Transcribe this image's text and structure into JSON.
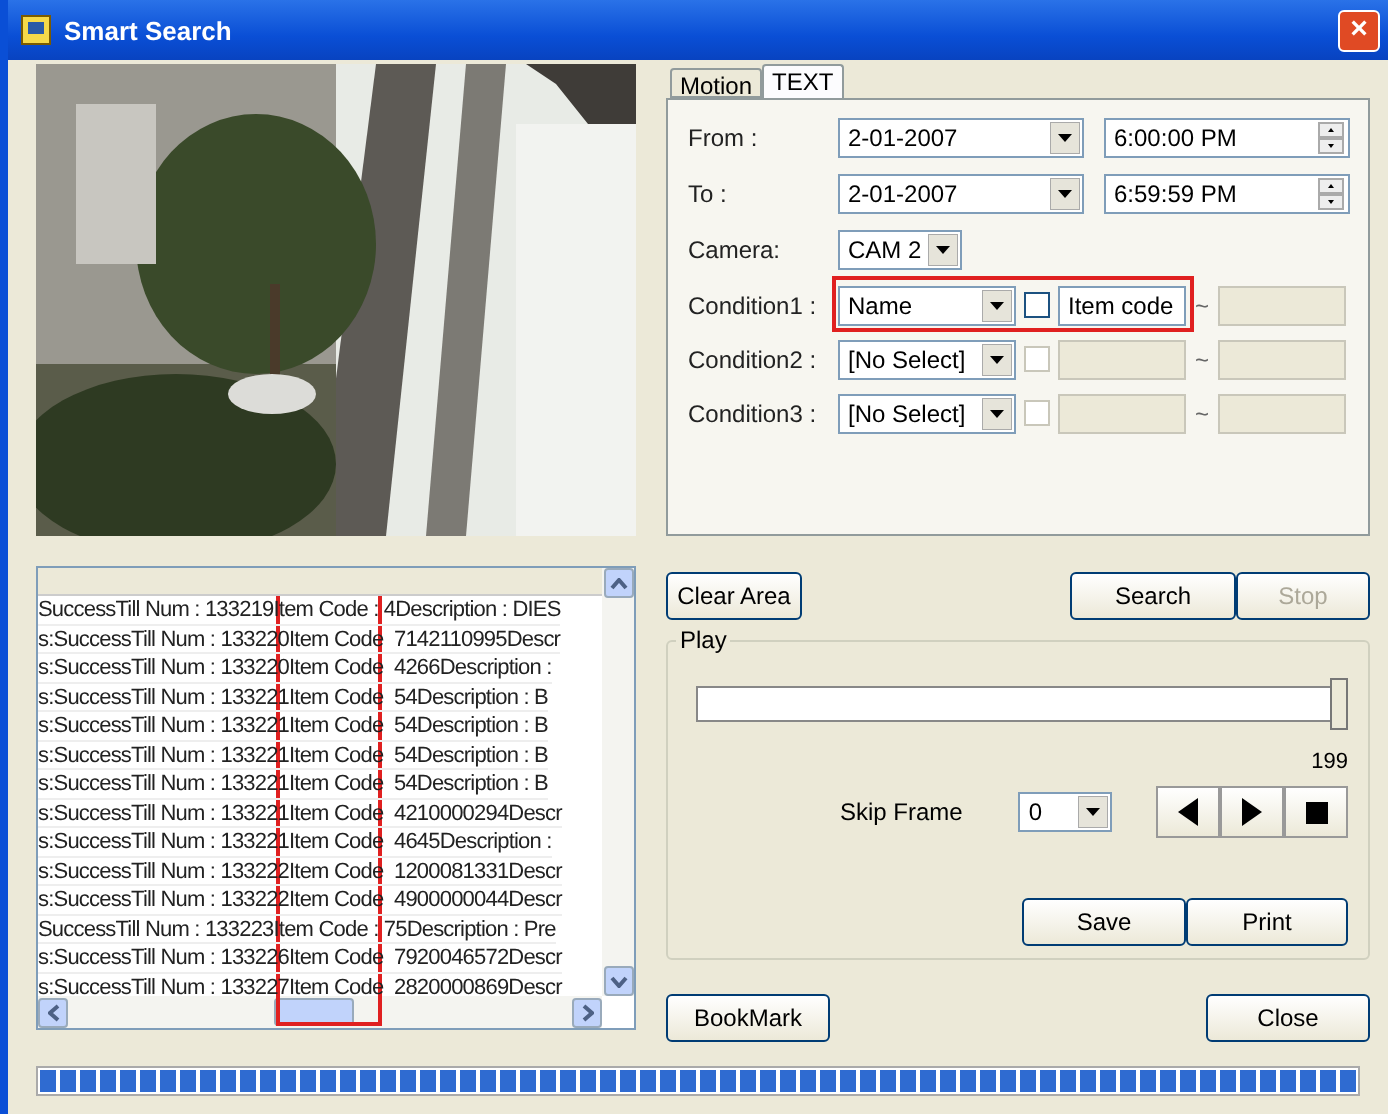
{
  "window": {
    "title": "Smart Search",
    "close": "×"
  },
  "log": {
    "highlighted": true,
    "rows": [
      "SuccessTill Num : 133219Item Code : 4Description : DIES",
      "s:SuccessTill Num : 133220Item Code  7142110995Descr",
      "s:SuccessTill Num : 133220Item Code  4266Description :",
      "s:SuccessTill Num : 133221Item Code  54Description : B",
      "s:SuccessTill Num : 133221Item Code  54Description : B",
      "s:SuccessTill Num : 133221Item Code  54Description : B",
      "s:SuccessTill Num : 133221Item Code  54Description : B",
      "s:SuccessTill Num : 133221Item Code  4210000294Descr",
      "s:SuccessTill Num : 133221Item Code  4645Description :",
      "s:SuccessTill Num : 133222Item Code  1200081331Descr",
      "s:SuccessTill Num : 133222Item Code  4900000044Descr",
      "SuccessTill Num : 133223Item Code : 75Description : Pre",
      "s:SuccessTill Num : 133226Item Code  7920046572Descr",
      "s:SuccessTill Num : 133227Item Code  2820000869Descr"
    ]
  },
  "tabs": [
    {
      "label": "Motion",
      "selected": false
    },
    {
      "label": "TEXT",
      "selected": true
    }
  ],
  "from": {
    "label": "From :",
    "date": "2-01-2007",
    "time": "6:00:00 PM"
  },
  "to": {
    "label": "To :",
    "date": "2-01-2007",
    "time": "6:59:59 PM"
  },
  "camera": {
    "label": "Camera:",
    "value": "CAM 2"
  },
  "conditions": [
    {
      "label": "Condition1 :",
      "field": "Name",
      "checked": false,
      "value": "Item code",
      "enabled": true,
      "highlighted": true,
      "tilde": "~"
    },
    {
      "label": "Condition2 :",
      "field": "[No Select]",
      "checked": false,
      "enabled": false,
      "highlighted": false,
      "tilde": "~"
    },
    {
      "label": "Condition3 :",
      "field": "[No Select]",
      "checked": false,
      "enabled": false,
      "highlighted": false,
      "tilde": "~"
    }
  ],
  "buttons": {
    "clear": {
      "label": "Clear Area",
      "disabled": false
    },
    "search": {
      "label": "Search",
      "disabled": false
    },
    "stop": {
      "label": "Stop",
      "disabled": true
    }
  },
  "play": {
    "title": "Play",
    "level": 1,
    "reading": "199",
    "skip_label": "Skip Frame",
    "skip_value": "0",
    "save": "Save",
    "print": "Print"
  },
  "bookmark": "BookMark",
  "close": "Close",
  "progress": {
    "level": 1
  }
}
